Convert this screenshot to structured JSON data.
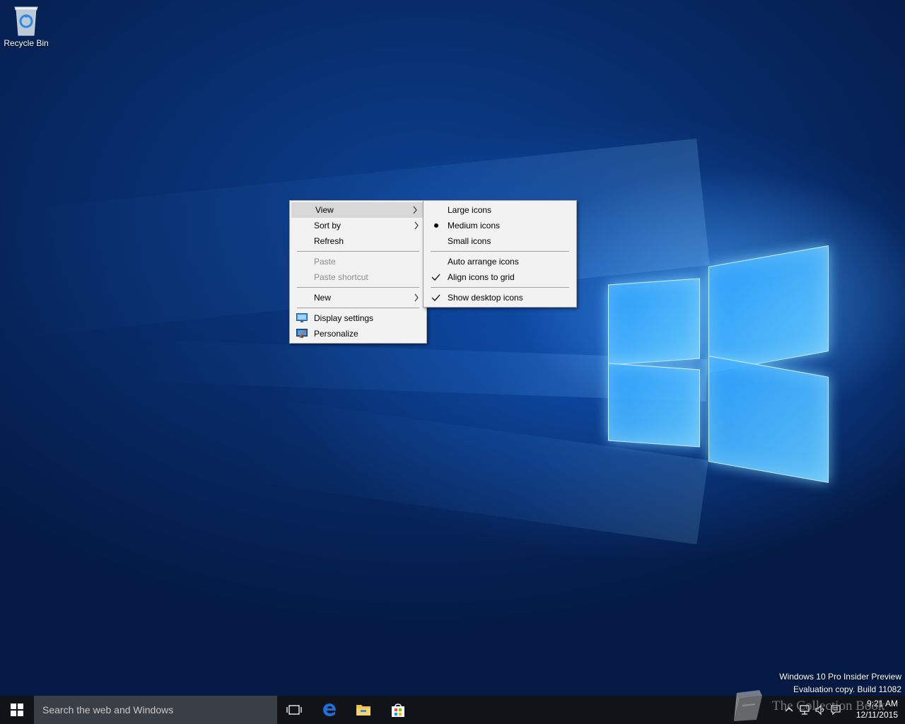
{
  "desktop": {
    "icons": [
      {
        "label": "Recycle Bin",
        "icon": "recycle-bin-icon"
      }
    ],
    "watermark": {
      "line1": "Windows 10 Pro Insider Preview",
      "line2": "Evaluation copy. Build 11082"
    }
  },
  "context_menu": {
    "items": [
      {
        "label": "View",
        "has_submenu": true,
        "highlighted": true
      },
      {
        "label": "Sort by",
        "has_submenu": true
      },
      {
        "label": "Refresh"
      },
      {
        "label": "Paste",
        "disabled": true
      },
      {
        "label": "Paste shortcut",
        "disabled": true
      },
      {
        "label": "New",
        "has_submenu": true
      },
      {
        "label": "Display settings",
        "icon": "display-settings-icon"
      },
      {
        "label": "Personalize",
        "icon": "personalize-icon"
      }
    ]
  },
  "view_submenu": {
    "items": [
      {
        "label": "Large icons"
      },
      {
        "label": "Medium icons",
        "mark": "bullet"
      },
      {
        "label": "Small icons"
      },
      {
        "label": "Auto arrange icons"
      },
      {
        "label": "Align icons to grid",
        "mark": "check"
      },
      {
        "label": "Show desktop icons",
        "mark": "check"
      }
    ]
  },
  "taskbar": {
    "search_placeholder": "Search the web and Windows",
    "pinned": [
      "task-view-icon",
      "edge-icon",
      "file-explorer-icon",
      "store-icon"
    ],
    "clock": {
      "time": "9:21 AM",
      "date": "12/11/2015"
    }
  },
  "overlay_watermark": "The Collection Book",
  "colors": {
    "taskbar_bg": "#101418",
    "search_bg": "#3a3f46",
    "menu_bg": "#f2f2f2",
    "menu_highlight": "#d8d8d8",
    "disabled_text": "#8d8d8d",
    "edge_blue": "#1e6fd9",
    "folder_yellow": "#f0c24a"
  }
}
